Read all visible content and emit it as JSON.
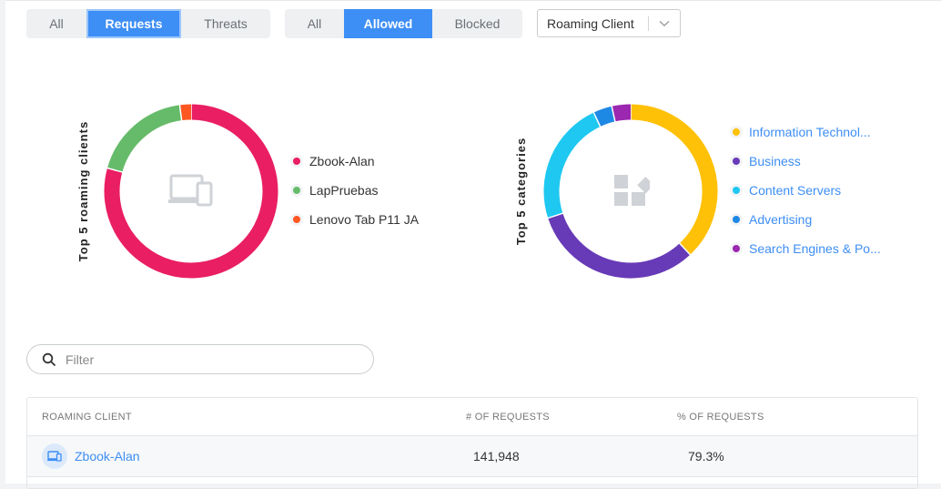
{
  "filters": {
    "type": {
      "options": [
        "All",
        "Requests",
        "Threats"
      ],
      "selected": "Requests"
    },
    "status": {
      "options": [
        "All",
        "Allowed",
        "Blocked"
      ],
      "selected": "Allowed"
    },
    "scope": {
      "value": "Roaming Client"
    }
  },
  "colors": {
    "accent": "#3d8ef5",
    "clients": [
      "#e91e63",
      "#66bb6a",
      "#ff5722"
    ],
    "categories": [
      "#ffc107",
      "#673ab7",
      "#1ec8f0",
      "#1e88e5",
      "#9c27b0"
    ]
  },
  "top_clients": {
    "title": "Top 5 roaming clients",
    "center_icon": "devices-icon",
    "legend": [
      "Zbook-Alan",
      "LapPruebas",
      "Lenovo Tab P11 JA"
    ]
  },
  "top_categories": {
    "title": "Top 5 categories",
    "center_icon": "widgets-icon",
    "legend": [
      "Information Technol...",
      "Business",
      "Content Servers",
      "Advertising",
      "Search Engines & Po..."
    ]
  },
  "chart_data": [
    {
      "type": "pie",
      "title": "Top 5 roaming clients",
      "categories": [
        "Zbook-Alan",
        "LapPruebas",
        "Lenovo Tab P11 JA"
      ],
      "values": [
        79.3,
        18.6,
        2.1
      ]
    },
    {
      "type": "pie",
      "title": "Top 5 categories",
      "categories": [
        "Information Technol...",
        "Business",
        "Content Servers",
        "Advertising",
        "Search Engines & Po..."
      ],
      "values": [
        38,
        32,
        23,
        3.5,
        3.5
      ]
    }
  ],
  "filter_input": {
    "placeholder": "Filter",
    "value": ""
  },
  "table": {
    "headers": [
      "ROAMING CLIENT",
      "# OF REQUESTS",
      "% OF REQUESTS"
    ],
    "rows": [
      {
        "client": "Zbook-Alan",
        "requests": "141,948",
        "percent": "79.3%"
      }
    ]
  }
}
